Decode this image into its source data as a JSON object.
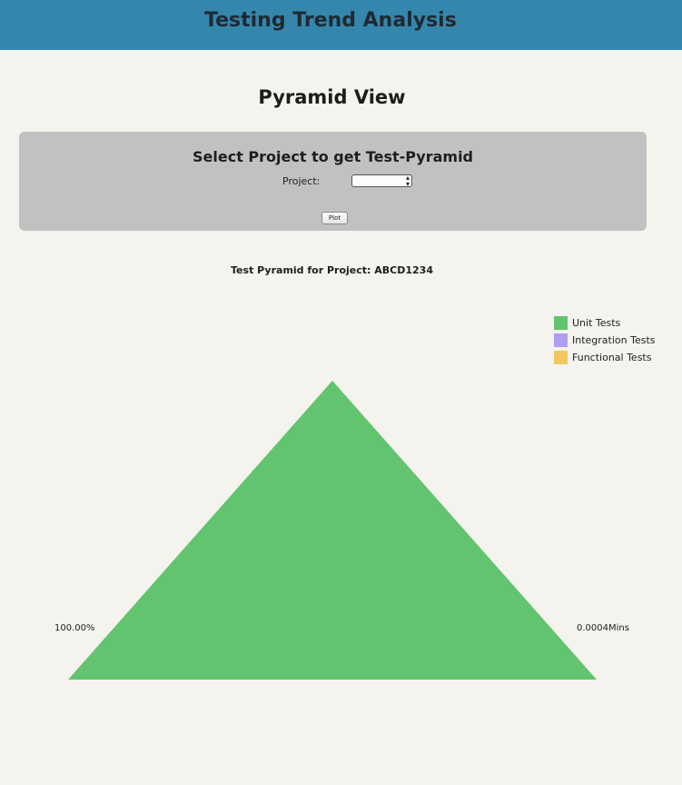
{
  "app": {
    "title": "Testing Trend Analysis"
  },
  "page": {
    "title": "Pyramid View"
  },
  "form": {
    "heading": "Select Project to get Test-Pyramid",
    "project_label": "Project:",
    "project_selected": "",
    "plot_button": "Plot"
  },
  "chart_data": {
    "type": "pyramid",
    "title": "Test Pyramid for Project: ABCD1234",
    "legend": "top-right",
    "series": [
      {
        "name": "Unit Tests",
        "color": "#62c46e",
        "share": 1.0
      },
      {
        "name": "Integration Tests",
        "color": "#b09cf0",
        "share": 0.0
      },
      {
        "name": "Functional Tests",
        "color": "#f3c760",
        "share": 0.0
      }
    ],
    "left_label": "100.00%",
    "right_label": "0.0004Mins"
  }
}
